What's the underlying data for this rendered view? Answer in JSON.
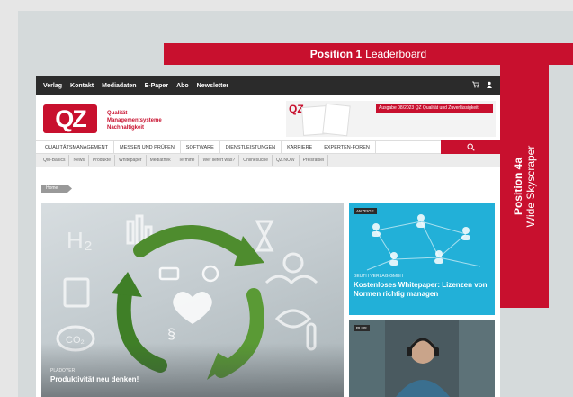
{
  "leaderboard": {
    "bold": "Position 1",
    "text": "Leaderboard"
  },
  "skyscraper": {
    "bold": "Position 4a",
    "text": "Wide Skyscraper"
  },
  "site": {
    "topnav": [
      "Verlag",
      "Kontakt",
      "Mediadaten",
      "E-Paper",
      "Abo",
      "Newsletter"
    ],
    "logo": "QZ",
    "tagline": [
      "Qualität",
      "Managementsysteme",
      "Nachhaltigkeit"
    ],
    "ad": {
      "logo": "QZ",
      "title": "Ausgabe 08/2023 QZ Qualität und Zuverlässigkeit"
    },
    "mainnav": [
      "QUALITÄTSMANAGEMENT",
      "MESSEN UND PRÜFEN",
      "SOFTWARE",
      "DIENSTLEISTUNGEN",
      "KARRIERE",
      "EXPERTEN-FOREN"
    ],
    "subnav": [
      "QM-Basics",
      "News",
      "Produkte",
      "Whitepaper",
      "Mediathek",
      "Termine",
      "Wer liefert was?",
      "Onlinesuche",
      "QZ.NOW",
      "Preisrätsel"
    ],
    "breadcrumb": "Home",
    "hero": {
      "kicker": "PLADOYER",
      "title": "Produktivität neu denken!"
    },
    "card1": {
      "badge": "ANZEIGE",
      "source": "BEUTH VERLAG GMBH",
      "title": "Kostenloses Whitepaper: Lizenzen von Normen richtig managen"
    },
    "card2": {
      "badge": "PLUS"
    }
  },
  "colors": {
    "accent": "#c8102e",
    "teal": "#22b0d8",
    "dark": "#2b2b2b"
  }
}
